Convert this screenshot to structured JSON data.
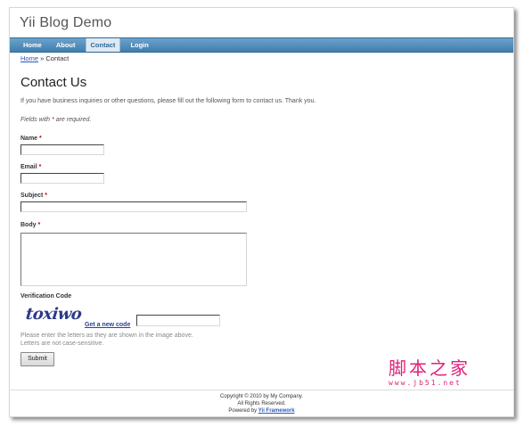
{
  "site": {
    "title": "Yii Blog Demo"
  },
  "nav": {
    "items": [
      {
        "label": "Home",
        "active": false
      },
      {
        "label": "About",
        "active": false
      },
      {
        "label": "Contact",
        "active": true
      },
      {
        "label": "Login",
        "active": false
      }
    ]
  },
  "breadcrumb": {
    "home": "Home",
    "separator": "»",
    "current": "Contact"
  },
  "page": {
    "title": "Contact Us",
    "intro": "If you have business inquiries or other questions, please fill out the following form to contact us. Thank you.",
    "required_note_prefix": "Fields with ",
    "required_note_star": "*",
    "required_note_suffix": " are required."
  },
  "form": {
    "name_label": "Name",
    "email_label": "Email",
    "subject_label": "Subject",
    "body_label": "Body",
    "required_mark": "*",
    "name_value": "",
    "email_value": "",
    "subject_value": "",
    "body_value": "",
    "verification_label": "Verification Code",
    "captcha_text": "toxiwo",
    "new_code_link": "Get a new code",
    "verification_value": "",
    "hint_line1": "Please enter the letters as they are shown in the image above.",
    "hint_line2": "Letters are not case-sensitive.",
    "submit_label": "Submit"
  },
  "footer": {
    "copyright": "Copyright © 2010 by My Company.",
    "rights": "All Rights Reserved.",
    "powered_prefix": "Powered by ",
    "powered_link": "Yii Framework"
  },
  "watermark": {
    "chinese": "脚本之家",
    "url": "www.jb51.net"
  },
  "colors": {
    "nav": "#3f7fb0",
    "link": "#2a5bb5",
    "watermark": "#e0207a"
  }
}
